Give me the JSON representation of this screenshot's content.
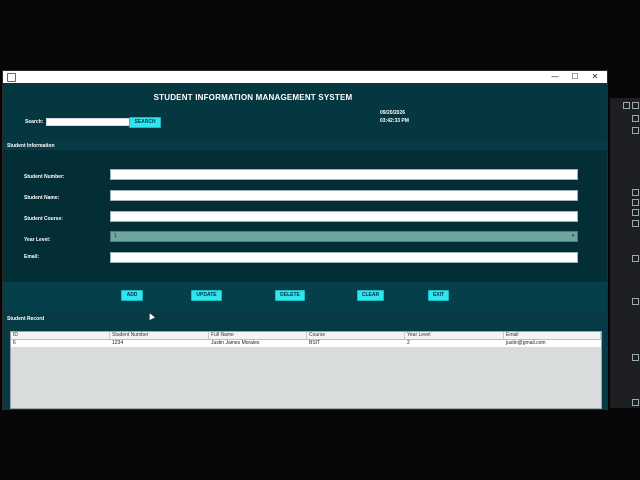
{
  "window": {
    "minimize_icon": "minimize-icon",
    "maximize_icon": "maximize-icon",
    "close_icon": "close-icon",
    "minimize_glyph": "—",
    "maximize_glyph": "☐",
    "close_glyph": "✕"
  },
  "header": {
    "title": "STUDENT INFORMATION MANAGEMENT SYSTEM",
    "search_label": "Search:",
    "search_value": "",
    "search_button": "SEARCH",
    "date": "09/20/2026",
    "time": "03:42:33 PM"
  },
  "form": {
    "section_label": "Student Information",
    "student_number_label": "Student Number:",
    "student_name_label": "Student Name:",
    "student_course_label": "Student Course:",
    "year_level_label": "Year Level:",
    "year_level_value": "1",
    "email_label": "Email:",
    "dropdown_glyph": "▾"
  },
  "actions": {
    "add": "ADD",
    "update": "UPDATE",
    "delete": "DELETE",
    "clear": "CLEAR",
    "exit": "EXIT"
  },
  "records": {
    "section_label": "Student Record",
    "columns": [
      "ID",
      "Student Number",
      "Full Name",
      "Course",
      "Year Level",
      "Email"
    ],
    "rows": [
      [
        "6",
        "1234",
        "Justin James Morales",
        "BSIT",
        "2",
        "justin@gmail.com"
      ]
    ]
  },
  "colors": {
    "panel": "#063a44",
    "button": "#2fe6f0",
    "select": "#6fa59f"
  }
}
